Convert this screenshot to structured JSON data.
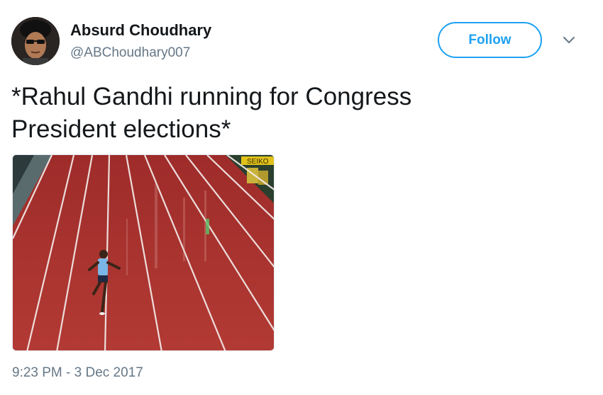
{
  "user": {
    "display_name": "Absurd Choudhary",
    "handle": "@ABChoudhary007",
    "avatar_icon": "profile-photo"
  },
  "actions": {
    "follow_label": "Follow",
    "more_icon": "chevron-down-icon"
  },
  "tweet": {
    "text_line1": "*Rahul Gandhi running for Congress",
    "text_line2": "President elections*",
    "media": {
      "description_icon": "photo",
      "sign_text": "SEIKO"
    },
    "timestamp": "9:23 PM - 3 Dec 2017"
  },
  "colors": {
    "accent": "#1da1f2",
    "text_primary": "#14171a",
    "text_secondary": "#657786",
    "track": "#a8332e"
  }
}
